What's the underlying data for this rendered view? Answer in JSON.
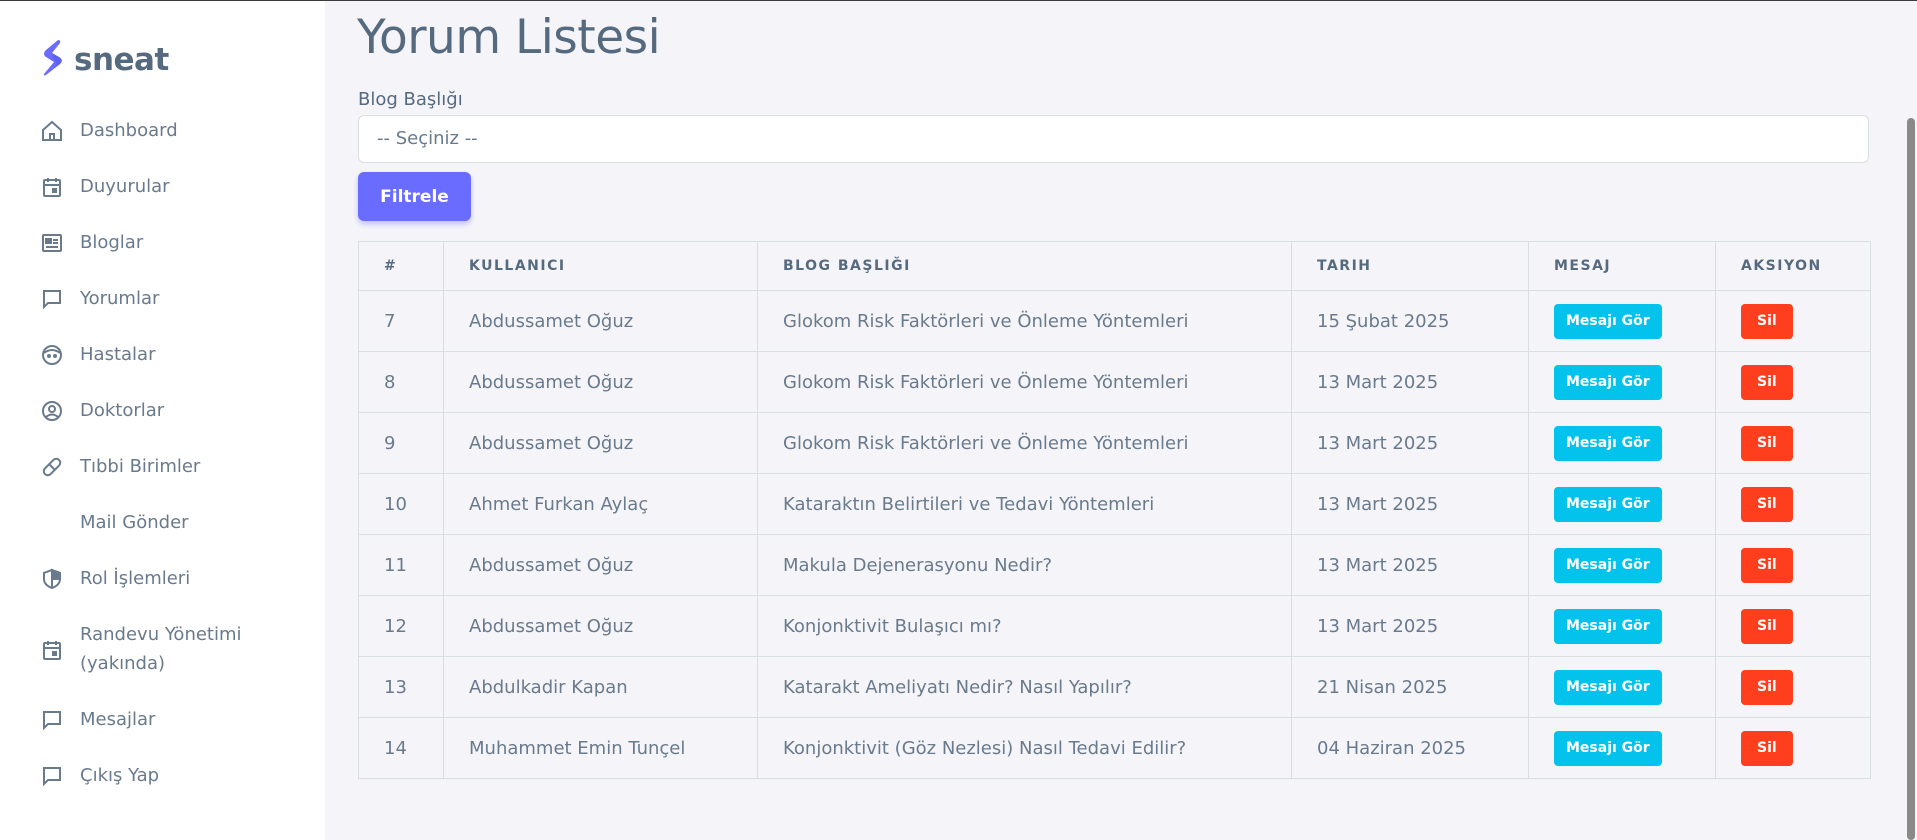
{
  "brand": {
    "name": "sneat",
    "color": "#696cff"
  },
  "sidebar": {
    "items": [
      {
        "label": "Dashboard",
        "icon": "home-icon"
      },
      {
        "label": "Duyurular",
        "icon": "calendar-icon"
      },
      {
        "label": "Bloglar",
        "icon": "news-icon"
      },
      {
        "label": "Yorumlar",
        "icon": "chat-icon"
      },
      {
        "label": "Hastalar",
        "icon": "face-icon"
      },
      {
        "label": "Doktorlar",
        "icon": "user-circle-icon"
      },
      {
        "label": "Tıbbi Birimler",
        "icon": "capsule-icon"
      },
      {
        "label": "Mail Gönder",
        "icon": ""
      },
      {
        "label": "Rol İşlemleri",
        "icon": "shield-icon"
      },
      {
        "label_line1": "Randevu Yönetimi",
        "label_line2": "(yakında)",
        "icon": "calendar-icon"
      },
      {
        "label": "Mesajlar",
        "icon": "chat-icon"
      },
      {
        "label": "Çıkış Yap",
        "icon": "chat-icon"
      }
    ]
  },
  "main": {
    "title": "Yorum Listesi",
    "filter_label": "Blog Başlığı",
    "select_value": "-- Seçiniz --",
    "filter_button": "Filtrele",
    "table": {
      "headers": [
        "#",
        "KULLANICI",
        "BLOG BAŞLIĞI",
        "TARIH",
        "MESAJ",
        "AKSIYON"
      ],
      "view_label": "Mesajı Gör",
      "delete_label": "Sil",
      "rows": [
        {
          "id": "7",
          "user": "Abdussamet Oğuz",
          "blog": "Glokom Risk Faktörleri ve Önleme Yöntemleri",
          "date": "15 Şubat 2025"
        },
        {
          "id": "8",
          "user": "Abdussamet Oğuz",
          "blog": "Glokom Risk Faktörleri ve Önleme Yöntemleri",
          "date": "13 Mart 2025"
        },
        {
          "id": "9",
          "user": "Abdussamet Oğuz",
          "blog": "Glokom Risk Faktörleri ve Önleme Yöntemleri",
          "date": "13 Mart 2025"
        },
        {
          "id": "10",
          "user": "Ahmet Furkan Aylaç",
          "blog": "Kataraktın Belirtileri ve Tedavi Yöntemleri",
          "date": "13 Mart 2025"
        },
        {
          "id": "11",
          "user": "Abdussamet Oğuz",
          "blog": "Makula Dejenerasyonu Nedir?",
          "date": "13 Mart 2025"
        },
        {
          "id": "12",
          "user": "Abdussamet Oğuz",
          "blog": "Konjonktivit Bulaşıcı mı?",
          "date": "13 Mart 2025"
        },
        {
          "id": "13",
          "user": "Abdulkadir Kapan",
          "blog": "Katarakt Ameliyatı Nedir? Nasıl Yapılır?",
          "date": "21 Nisan 2025"
        },
        {
          "id": "14",
          "user": "Muhammet Emin Tunçel",
          "blog": "Konjonktivit (Göz Nezlesi) Nasıl Tedavi Edilir?",
          "date": "04 Haziran 2025"
        }
      ]
    }
  },
  "colors": {
    "primary": "#696cff",
    "info": "#03c3ec",
    "danger": "#ff3e1d",
    "background": "#f5f5f9"
  }
}
